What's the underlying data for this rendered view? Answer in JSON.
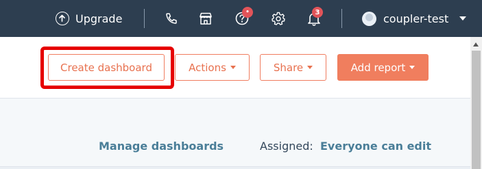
{
  "topbar": {
    "upgrade_label": "Upgrade",
    "notifications_badge": "•",
    "bell_badge_count": "3",
    "account_name": "coupler-test"
  },
  "header": {
    "create_dashboard_label": "Create dashboard",
    "actions_label": "Actions",
    "share_label": "Share",
    "add_report_label": "Add report"
  },
  "content": {
    "manage_dashboards_label": "Manage dashboards",
    "assigned_label": "Assigned:",
    "assigned_value": "Everyone can edit"
  },
  "colors": {
    "topbar_bg": "#2d3e50",
    "accent": "#f07e5e",
    "highlight_border": "#e60000",
    "badge": "#e25459",
    "link": "#4a7e98"
  }
}
